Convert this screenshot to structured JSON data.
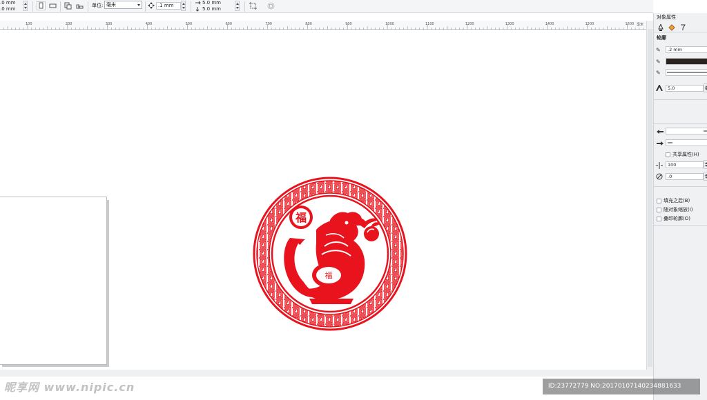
{
  "toolbar": {
    "size_w": ".0 mm",
    "size_h": ".0 mm",
    "unit_label": "单位:",
    "unit_value": "毫米",
    "nudge_value": ".1 mm",
    "dup_x": "5.0 mm",
    "dup_y": "5.0 mm"
  },
  "ruler": {
    "labels": [
      "100",
      "200",
      "300",
      "400",
      "500",
      "600",
      "700",
      "800",
      "900",
      "1000",
      "1100",
      "1200",
      "1300",
      "1400",
      "1500",
      "1600"
    ],
    "unit": "毫米"
  },
  "panel": {
    "title": "对象属性",
    "section_title": "轮廓",
    "outline_width": ".2 mm",
    "miter_value": "5.0",
    "share_attr_label": "共享属性(H)",
    "stretch_value": "100",
    "angle_value": ".0",
    "behind_fill_label": "填充之后(B)",
    "scale_with_object_label": "随对象缩放(I)",
    "overprint_outline_label": "叠印轮廓(O)",
    "outline_color": "#2b2320"
  },
  "emblem": {
    "color": "#e8131d",
    "left_glyph": "福",
    "center_glyph": "福"
  },
  "watermark": {
    "site_text": "昵享网 www.nipic.cn",
    "id_text": "ID:23772779 NO:20170107140234881633"
  },
  "colors": {
    "toolbar_bg": "#f4f5f7",
    "panel_bg": "#f0f1f3",
    "canvas_bg": "#ffffff",
    "emblem_red": "#e8131d"
  }
}
